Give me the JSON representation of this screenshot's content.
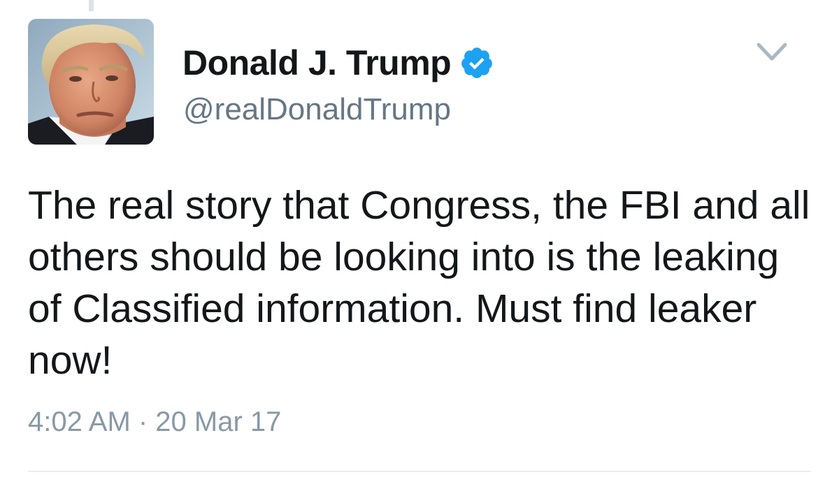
{
  "tweet": {
    "author": {
      "display_name": "Donald J. Trump",
      "handle": "@realDonaldTrump",
      "verified_icon": "verified-badge-icon",
      "avatar_icon": "profile-photo"
    },
    "text": "The real story that Congress, the FBI and all others should be looking into is the leaking of Classified information. Must find leaker now!",
    "timestamp": "4:02 AM · 20 Mar 17",
    "menu_icon": "chevron-down-icon"
  },
  "colors": {
    "name": "#14171a",
    "handle": "#657786",
    "timestamp": "#8899a6",
    "verified": "#1da1f2",
    "caret": "#aab8c2",
    "divider": "#e6ecf0"
  }
}
